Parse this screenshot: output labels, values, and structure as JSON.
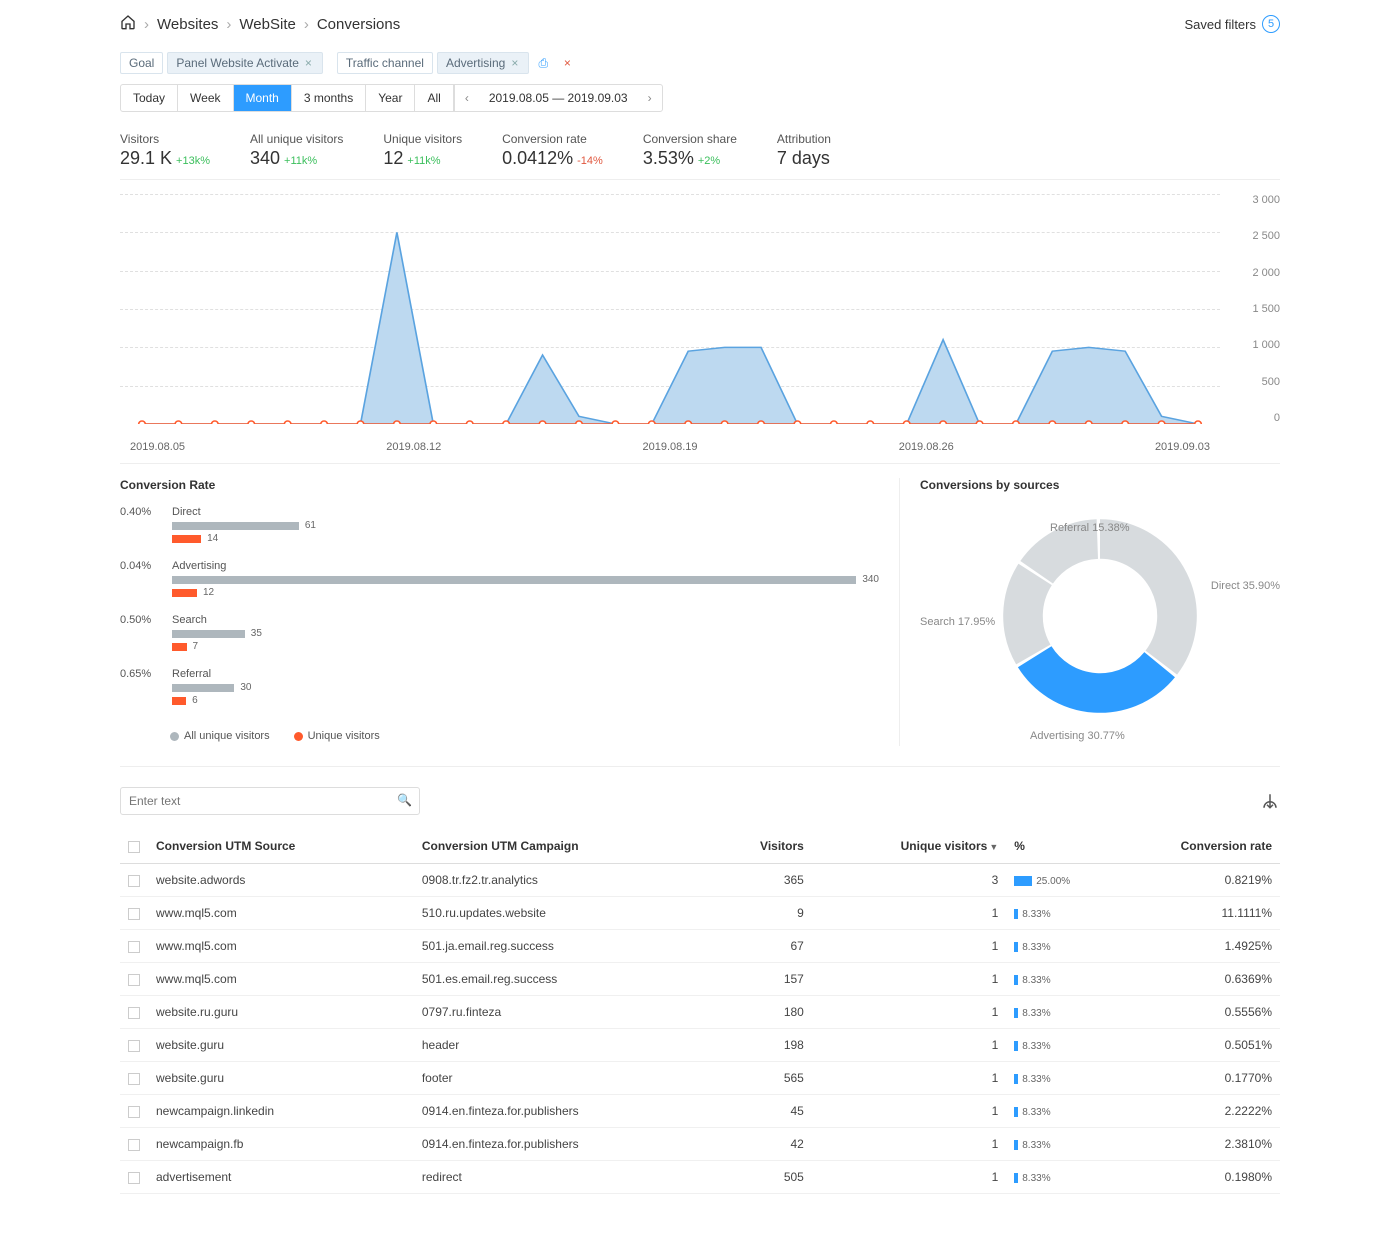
{
  "breadcrumb": {
    "home": "Websites",
    "site": "WebSite",
    "page": "Conversions"
  },
  "saved_filters": {
    "label": "Saved filters",
    "count": "5"
  },
  "filter_chips": {
    "goal_label": "Goal",
    "goal_value": "Panel Website Activate",
    "traffic_label": "Traffic channel",
    "traffic_value": "Advertising"
  },
  "periods": [
    "Today",
    "Week",
    "Month",
    "3 months",
    "Year",
    "All"
  ],
  "active_period": "Month",
  "date_range": "2019.08.05 — 2019.09.03",
  "metrics": {
    "visitors": {
      "label": "Visitors",
      "value": "29.1 K",
      "delta": "+13k%",
      "dir": "up"
    },
    "all_unique": {
      "label": "All unique visitors",
      "value": "340",
      "delta": "+11k%",
      "dir": "up"
    },
    "unique": {
      "label": "Unique visitors",
      "value": "12",
      "delta": "+11k%",
      "dir": "up"
    },
    "conv_rate": {
      "label": "Conversion rate",
      "value": "0.0412%",
      "delta": "-14%",
      "dir": "down"
    },
    "conv_share": {
      "label": "Conversion share",
      "value": "3.53%",
      "delta": "+2%",
      "dir": "up"
    },
    "attribution": {
      "label": "Attribution",
      "value": "7 days",
      "delta": "",
      "dir": ""
    }
  },
  "chart_data": {
    "type": "area",
    "title": "",
    "xlabel": "",
    "ylabel": "",
    "ylim": [
      0,
      3000
    ],
    "y_ticks": [
      "3 000",
      "2 500",
      "2 000",
      "1 500",
      "1 000",
      "500",
      "0"
    ],
    "x_ticks": [
      "2019.08.05",
      "2019.08.12",
      "2019.08.19",
      "2019.08.26",
      "2019.09.03"
    ],
    "series": [
      {
        "name": "Visitors",
        "color": "#a8cef0",
        "x": [
          "2019.08.05",
          "2019.08.06",
          "2019.08.07",
          "2019.08.08",
          "2019.08.09",
          "2019.08.10",
          "2019.08.11",
          "2019.08.12",
          "2019.08.13",
          "2019.08.14",
          "2019.08.15",
          "2019.08.16",
          "2019.08.17",
          "2019.08.18",
          "2019.08.19",
          "2019.08.20",
          "2019.08.21",
          "2019.08.22",
          "2019.08.23",
          "2019.08.24",
          "2019.08.25",
          "2019.08.26",
          "2019.08.27",
          "2019.08.28",
          "2019.08.29",
          "2019.08.30",
          "2019.08.31",
          "2019.09.01",
          "2019.09.02",
          "2019.09.03"
        ],
        "values": [
          0,
          0,
          0,
          0,
          0,
          0,
          0,
          2500,
          0,
          0,
          0,
          900,
          100,
          0,
          0,
          950,
          1000,
          1000,
          0,
          0,
          0,
          0,
          1100,
          0,
          0,
          950,
          1000,
          950,
          100,
          0
        ]
      },
      {
        "name": "Unique visitors",
        "color": "#ff5a2c",
        "x": [
          "2019.08.05",
          "2019.08.06",
          "2019.08.07",
          "2019.08.08",
          "2019.08.09",
          "2019.08.10",
          "2019.08.11",
          "2019.08.12",
          "2019.08.13",
          "2019.08.14",
          "2019.08.15",
          "2019.08.16",
          "2019.08.17",
          "2019.08.18",
          "2019.08.19",
          "2019.08.20",
          "2019.08.21",
          "2019.08.22",
          "2019.08.23",
          "2019.08.24",
          "2019.08.25",
          "2019.08.26",
          "2019.08.27",
          "2019.08.28",
          "2019.08.29",
          "2019.08.30",
          "2019.08.31",
          "2019.09.01",
          "2019.09.02",
          "2019.09.03"
        ],
        "values": [
          0,
          0,
          0,
          0,
          0,
          0,
          0,
          0,
          0,
          0,
          0,
          0,
          0,
          0,
          0,
          0,
          0,
          0,
          0,
          0,
          0,
          0,
          0,
          0,
          0,
          0,
          0,
          0,
          0,
          0
        ]
      }
    ]
  },
  "conv_rate": {
    "title": "Conversion Rate",
    "rows": [
      {
        "pct": "0.40%",
        "name": "Direct",
        "all": 61,
        "unique": 14
      },
      {
        "pct": "0.04%",
        "name": "Advertising",
        "all": 340,
        "unique": 12
      },
      {
        "pct": "0.50%",
        "name": "Search",
        "all": 35,
        "unique": 7
      },
      {
        "pct": "0.65%",
        "name": "Referral",
        "all": 30,
        "unique": 6
      }
    ],
    "legend": {
      "all": "All unique visitors",
      "unique": "Unique visitors"
    },
    "max_all": 340
  },
  "donut": {
    "title": "Conversions by sources",
    "type": "pie",
    "slices": [
      {
        "name": "Referral",
        "pct": 15.38,
        "label": "Referral 15.38%"
      },
      {
        "name": "Direct",
        "pct": 35.9,
        "label": "Direct 35.90%"
      },
      {
        "name": "Advertising",
        "pct": 30.77,
        "label": "Advertising 30.77%"
      },
      {
        "name": "Search",
        "pct": 17.95,
        "label": "Search 17.95%"
      }
    ]
  },
  "table": {
    "search_placeholder": "Enter text",
    "cols": {
      "source": "Conversion UTM Source",
      "campaign": "Conversion UTM Campaign",
      "visitors": "Visitors",
      "unique": "Unique visitors",
      "pct": "%",
      "rate": "Conversion rate"
    },
    "rows": [
      {
        "source": "website.adwords",
        "campaign": "0908.tr.fz2.tr.analytics",
        "visitors": 365,
        "unique": 3,
        "pct": "25.00%",
        "rate": "0.8219%"
      },
      {
        "source": "www.mql5.com",
        "campaign": "510.ru.updates.website",
        "visitors": 9,
        "unique": 1,
        "pct": "8.33%",
        "rate": "11.1111%"
      },
      {
        "source": "www.mql5.com",
        "campaign": "501.ja.email.reg.success",
        "visitors": 67,
        "unique": 1,
        "pct": "8.33%",
        "rate": "1.4925%"
      },
      {
        "source": "www.mql5.com",
        "campaign": "501.es.email.reg.success",
        "visitors": 157,
        "unique": 1,
        "pct": "8.33%",
        "rate": "0.6369%"
      },
      {
        "source": "website.ru.guru",
        "campaign": "0797.ru.finteza",
        "visitors": 180,
        "unique": 1,
        "pct": "8.33%",
        "rate": "0.5556%"
      },
      {
        "source": "website.guru",
        "campaign": "header",
        "visitors": 198,
        "unique": 1,
        "pct": "8.33%",
        "rate": "0.5051%"
      },
      {
        "source": "website.guru",
        "campaign": "footer",
        "visitors": 565,
        "unique": 1,
        "pct": "8.33%",
        "rate": "0.1770%"
      },
      {
        "source": "newcampaign.linkedin",
        "campaign": "0914.en.finteza.for.publishers",
        "visitors": 45,
        "unique": 1,
        "pct": "8.33%",
        "rate": "2.2222%"
      },
      {
        "source": "newcampaign.fb",
        "campaign": "0914.en.finteza.for.publishers",
        "visitors": 42,
        "unique": 1,
        "pct": "8.33%",
        "rate": "2.3810%"
      },
      {
        "source": "advertisement",
        "campaign": "redirect",
        "visitors": 505,
        "unique": 1,
        "pct": "8.33%",
        "rate": "0.1980%"
      }
    ]
  }
}
